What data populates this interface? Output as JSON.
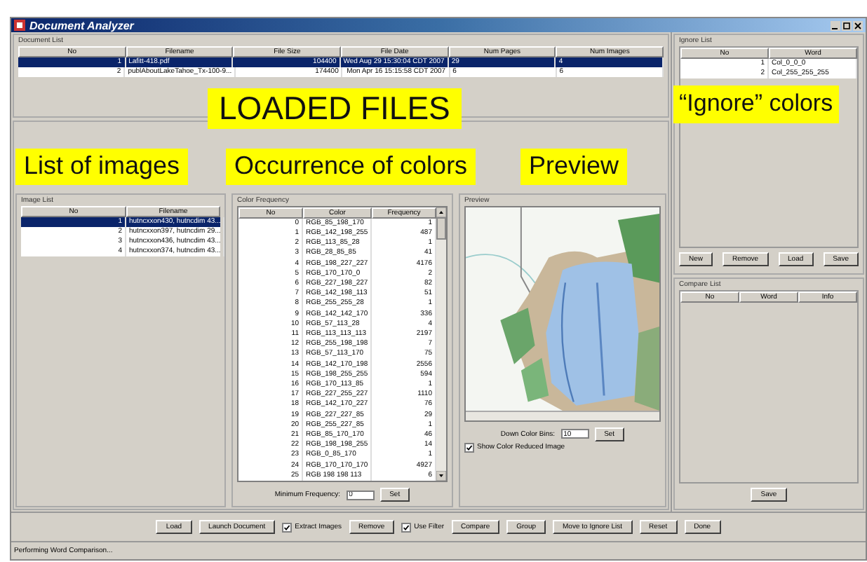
{
  "window": {
    "title": "Document Analyzer"
  },
  "document_list": {
    "title": "Document List",
    "columns": [
      "No",
      "Filename",
      "File Size",
      "File Date",
      "Num Pages",
      "Num Images"
    ],
    "rows": [
      {
        "no": "1",
        "filename": "Lafitt-418.pdf",
        "file_size": "104400",
        "file_date": "Wed Aug 29 15:30:04 CDT 2007",
        "num_pages": "29",
        "num_images": "4",
        "selected": true
      },
      {
        "no": "2",
        "filename": "publAboutLakeTahoe_Tx-100-9...",
        "file_size": "174400",
        "file_date": "Mon Apr 16 15:15:58 CDT 2007",
        "num_pages": "6",
        "num_images": "6",
        "selected": false
      }
    ]
  },
  "ignore_list": {
    "title": "Ignore List",
    "columns": [
      "No",
      "Word"
    ],
    "rows": [
      {
        "no": "1",
        "word": "Col_0_0_0"
      },
      {
        "no": "2",
        "word": "Col_255_255_255"
      }
    ],
    "buttons": [
      "New",
      "Remove",
      "Load",
      "Save"
    ]
  },
  "image_list": {
    "title": "Image List",
    "columns": [
      "No",
      "Filename"
    ],
    "rows": [
      {
        "no": "1",
        "filename": "hutncxxon430, hutncdim 43...",
        "selected": true
      },
      {
        "no": "2",
        "filename": "hutncxxon397, hutncdim 29...",
        "selected": false
      },
      {
        "no": "3",
        "filename": "hutncxxon436, hutncdim 43...",
        "selected": false
      },
      {
        "no": "4",
        "filename": "hutncxxon374, hutncdim 43...",
        "selected": false
      }
    ]
  },
  "color_frequency": {
    "title": "Color Frequency",
    "columns": [
      "No",
      "Color",
      "Frequency"
    ],
    "rows": [
      {
        "no": "0",
        "rgb_name": "RGB_85_198_170",
        "frequency": "1"
      },
      {
        "no": "1",
        "rgb_name": "RGB_142_198_255",
        "frequency": "487"
      },
      {
        "no": "2",
        "rgb_name": "RGB_113_85_28",
        "frequency": "1"
      },
      {
        "no": "3",
        "rgb_name": "RGB_28_85_85",
        "frequency": "41"
      },
      {
        "no": "4",
        "rgb_name": "RGB_198_227_227",
        "frequency": "4176"
      },
      {
        "no": "5",
        "rgb_name": "RGB_170_170_0",
        "frequency": "2"
      },
      {
        "no": "6",
        "rgb_name": "RGB_227_198_227",
        "frequency": "82"
      },
      {
        "no": "7",
        "rgb_name": "RGB_142_198_113",
        "frequency": "51"
      },
      {
        "no": "8",
        "rgb_name": "RGB_255_255_28",
        "frequency": "1"
      },
      {
        "no": "9",
        "rgb_name": "RGB_142_142_170",
        "frequency": "336"
      },
      {
        "no": "10",
        "rgb_name": "RGB_57_113_28",
        "frequency": "4"
      },
      {
        "no": "11",
        "rgb_name": "RGB_113_113_113",
        "frequency": "2197"
      },
      {
        "no": "12",
        "rgb_name": "RGB_255_198_198",
        "frequency": "7"
      },
      {
        "no": "13",
        "rgb_name": "RGB_57_113_170",
        "frequency": "75"
      },
      {
        "no": "14",
        "rgb_name": "RGB_142_170_198",
        "frequency": "2556"
      },
      {
        "no": "15",
        "rgb_name": "RGB_198_255_255",
        "frequency": "594"
      },
      {
        "no": "16",
        "rgb_name": "RGB_170_113_85",
        "frequency": "1"
      },
      {
        "no": "17",
        "rgb_name": "RGB_227_255_227",
        "frequency": "1110"
      },
      {
        "no": "18",
        "rgb_name": "RGB_142_170_227",
        "frequency": "76"
      },
      {
        "no": "19",
        "rgb_name": "RGB_227_227_85",
        "frequency": "29"
      },
      {
        "no": "20",
        "rgb_name": "RGB_255_227_85",
        "frequency": "1"
      },
      {
        "no": "21",
        "rgb_name": "RGB_85_170_170",
        "frequency": "46"
      },
      {
        "no": "22",
        "rgb_name": "RGB_198_198_255",
        "frequency": "14"
      },
      {
        "no": "23",
        "rgb_name": "RGB_0_85_170",
        "frequency": "1"
      },
      {
        "no": "24",
        "rgb_name": "RGB_170_170_170",
        "frequency": "4927"
      },
      {
        "no": "25",
        "rgb_name": "RGB 198 198 113",
        "frequency": "6"
      }
    ],
    "min_label": "Minimum Frequency:",
    "min_value": "0",
    "set_button": "Set"
  },
  "preview": {
    "title": "Preview",
    "bins_label": "Down Color Bins:",
    "bins_value": "10",
    "set_button": "Set",
    "show_reduced": {
      "label": "Show Color Reduced Image",
      "checked": true
    }
  },
  "compare_list": {
    "title": "Compare List",
    "columns": [
      "No",
      "Word",
      "Info"
    ],
    "buttons": [
      "Save"
    ]
  },
  "toolbar": [
    {
      "kind": "button",
      "label": "Load"
    },
    {
      "kind": "button",
      "label": "Launch Document"
    },
    {
      "kind": "checkbox",
      "label": "Extract Images",
      "checked": true
    },
    {
      "kind": "button",
      "label": "Remove"
    },
    {
      "kind": "checkbox",
      "label": "Use Filter",
      "checked": true
    },
    {
      "kind": "button",
      "label": "Compare"
    },
    {
      "kind": "button",
      "label": "Group"
    },
    {
      "kind": "button",
      "label": "Move to Ignore List"
    },
    {
      "kind": "button",
      "label": "Reset"
    },
    {
      "kind": "button",
      "label": "Done"
    }
  ],
  "status_bar": "Performing Word Comparison...",
  "annotations": [
    "LOADED FILES",
    "“Ignore” colors",
    "List of images",
    "Occurrence of colors",
    "Preview"
  ]
}
